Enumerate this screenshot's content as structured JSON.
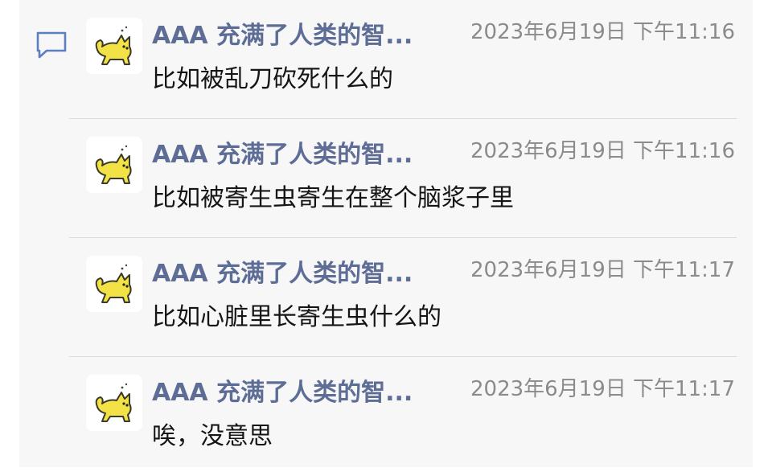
{
  "messages": [
    {
      "name": "AAA 充满了人类的智...",
      "time": "2023年6月19日 下午11:16",
      "text": "比如被乱刀砍死什么的"
    },
    {
      "name": "AAA 充满了人类的智...",
      "time": "2023年6月19日 下午11:16",
      "text": "比如被寄生虫寄生在整个脑浆子里"
    },
    {
      "name": "AAA 充满了人类的智...",
      "time": "2023年6月19日 下午11:17",
      "text": "比如心脏里长寄生虫什么的"
    },
    {
      "name": "AAA 充满了人类的智...",
      "time": "2023年6月19日 下午11:17",
      "text": "唉，没意思"
    }
  ],
  "icons": {
    "comment": "comment-icon",
    "avatar": "yellow-cat-avatar"
  },
  "colors": {
    "name": "#5e6d96",
    "time": "#8b8b8b",
    "text": "#151515",
    "panel_bg": "#f7f7f7",
    "icon_accent": "#5b7fbf"
  }
}
